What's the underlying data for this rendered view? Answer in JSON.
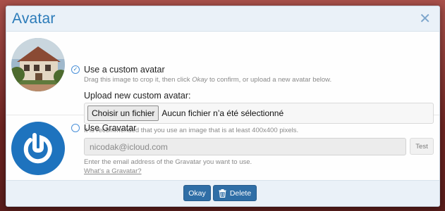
{
  "dialog": {
    "title": "Avatar",
    "close_icon": "close-icon"
  },
  "custom_avatar": {
    "option_label": "Use a custom avatar",
    "selected": true,
    "hint_before": "Drag this image to crop it, then click ",
    "hint_emph": "Okay",
    "hint_after": " to confirm, or upload a new avatar below.",
    "upload_label": "Upload new custom avatar:",
    "file_button_label": "Choisir un fichier",
    "file_status": "Aucun fichier n’a été sélectionné",
    "recommendation": "It is recommended that you use an image that is at least 400x400 pixels."
  },
  "gravatar": {
    "option_label": "Use Gravatar",
    "selected": false,
    "email_value": "nicodak@icloud.com",
    "test_label": "Test",
    "hint": "Enter the email address of the Gravatar you want to use.",
    "link_text": "What's a Gravatar?",
    "logo_color": "#1e73be"
  },
  "footer": {
    "okay_label": "Okay",
    "delete_label": "Delete",
    "delete_icon": "trash-icon",
    "button_color": "#2f6ea6"
  },
  "colors": {
    "accent": "#2b7bb9",
    "header_bg": "#eaf1f8"
  }
}
